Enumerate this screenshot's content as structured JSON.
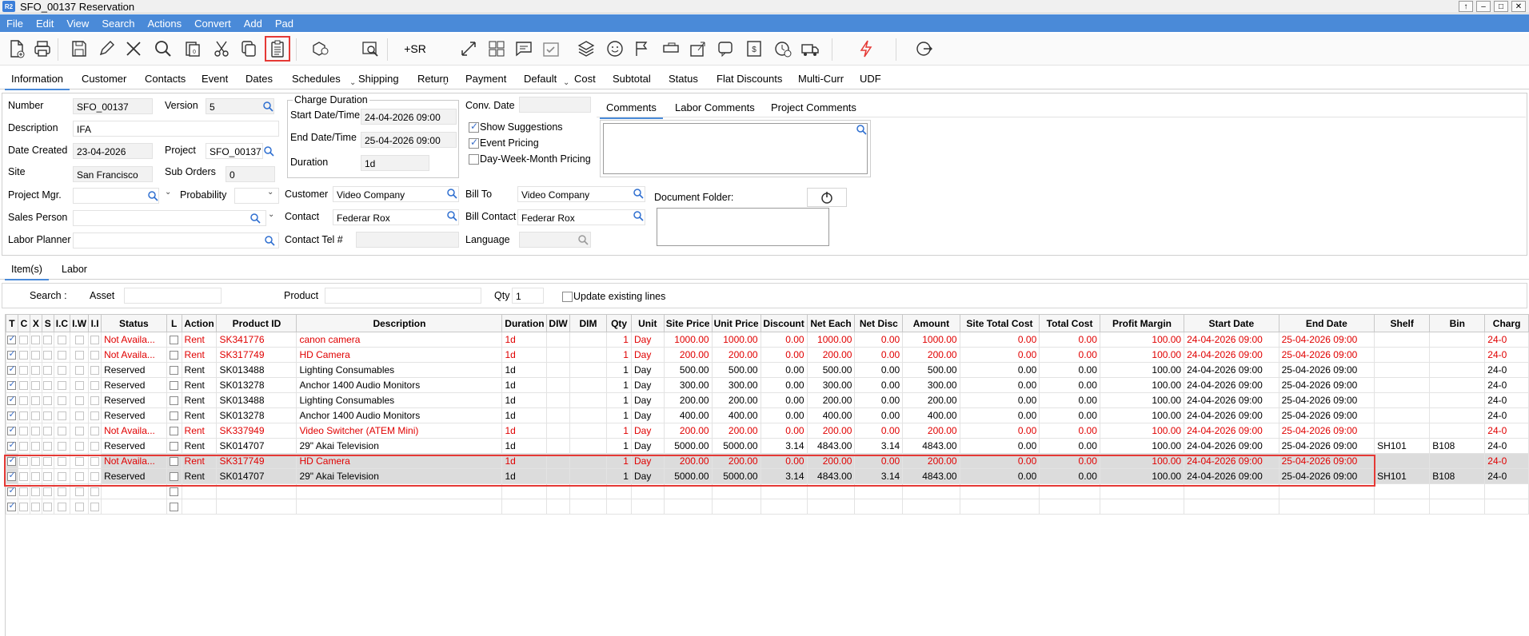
{
  "window": {
    "app_badge": "R2",
    "title": "SFO_00137 Reservation"
  },
  "menu": [
    "File",
    "Edit",
    "View",
    "Search",
    "Actions",
    "Convert",
    "Add",
    "Pad"
  ],
  "toolbar": {
    "sr_label": "+SR"
  },
  "tabs": [
    "Information",
    "Customer",
    "Contacts",
    "Event",
    "Dates",
    "Schedules",
    "Shipping",
    "Return",
    "Payment",
    "Default",
    "Cost",
    "Subtotal",
    "Status",
    "Flat Discounts",
    "Multi-Curr",
    "UDF"
  ],
  "form": {
    "number_label": "Number",
    "number": "SFO_00137",
    "version_label": "Version",
    "version": "5",
    "description_label": "Description",
    "description": "IFA",
    "date_created_label": "Date Created",
    "date_created": "23-04-2026",
    "project_label": "Project",
    "project": "SFO_00137",
    "site_label": "Site",
    "site": "San Francisco",
    "sub_orders_label": "Sub Orders",
    "sub_orders": "0",
    "project_mgr_label": "Project Mgr.",
    "probability_label": "Probability",
    "sales_person_label": "Sales Person",
    "labor_planner_label": "Labor Planner",
    "charge_duration_title": "Charge Duration",
    "start_label": "Start Date/Time",
    "start": "24-04-2026 09:00",
    "end_label": "End Date/Time",
    "end": "25-04-2026 09:00",
    "duration_label": "Duration",
    "duration": "1d",
    "conv_date_label": "Conv. Date",
    "show_suggestions": "Show Suggestions",
    "event_pricing": "Event Pricing",
    "dwm_pricing": "Day-Week-Month Pricing",
    "customer_label": "Customer",
    "customer": "Video Company",
    "contact_label": "Contact",
    "contact": "Federar Rox",
    "contact_tel_label": "Contact Tel #",
    "bill_to_label": "Bill To",
    "bill_to": "Video Company",
    "bill_contact_label": "Bill Contact",
    "bill_contact": "Federar Rox",
    "language_label": "Language",
    "comment_tabs": [
      "Comments",
      "Labor Comments",
      "Project Comments"
    ],
    "document_folder_label": "Document Folder:"
  },
  "subtabs": [
    "Item(s)",
    "Labor"
  ],
  "search": {
    "label": "Search :",
    "asset": "Asset",
    "product": "Product",
    "qty_label": "Qty",
    "qty": "1",
    "update_lines": "Update existing lines"
  },
  "grid": {
    "headers": [
      "T",
      "C",
      "X",
      "S",
      "I.C",
      "I.W",
      "I.I",
      "Status",
      "L",
      "Action",
      "Product ID",
      "Description",
      "Duration",
      "DIW",
      "DIM",
      "Qty",
      "Unit",
      "Site Price",
      "Unit Price",
      "Discount",
      "Net Each",
      "Net Disc",
      "Amount",
      "Site Total Cost",
      "Total Cost",
      "Profit Margin",
      "Start Date",
      "End Date",
      "Shelf",
      "Bin",
      "Charg"
    ],
    "rows": [
      {
        "red": true,
        "sel": false,
        "status": "Not Availa...",
        "action": "Rent",
        "pid": "SK341776",
        "desc": "canon camera",
        "dur": "1d",
        "qty": "1",
        "unit": "Day",
        "site_price": "1000.00",
        "unit_price": "1000.00",
        "disc": "0.00",
        "net_each": "1000.00",
        "net_disc": "0.00",
        "amount": "1000.00",
        "site_cost": "0.00",
        "total_cost": "0.00",
        "margin": "100.00",
        "start": "24-04-2026 09:00",
        "end": "25-04-2026 09:00",
        "shelf": "",
        "bin": "",
        "charge": "24-0"
      },
      {
        "red": true,
        "sel": false,
        "status": "Not Availa...",
        "action": "Rent",
        "pid": "SK317749",
        "desc": "HD Camera",
        "dur": "1d",
        "qty": "1",
        "unit": "Day",
        "site_price": "200.00",
        "unit_price": "200.00",
        "disc": "0.00",
        "net_each": "200.00",
        "net_disc": "0.00",
        "amount": "200.00",
        "site_cost": "0.00",
        "total_cost": "0.00",
        "margin": "100.00",
        "start": "24-04-2026 09:00",
        "end": "25-04-2026 09:00",
        "shelf": "",
        "bin": "",
        "charge": "24-0"
      },
      {
        "red": false,
        "sel": false,
        "status": "Reserved",
        "action": "Rent",
        "pid": "SK013488",
        "desc": "Lighting Consumables",
        "dur": "1d",
        "qty": "1",
        "unit": "Day",
        "site_price": "500.00",
        "unit_price": "500.00",
        "disc": "0.00",
        "net_each": "500.00",
        "net_disc": "0.00",
        "amount": "500.00",
        "site_cost": "0.00",
        "total_cost": "0.00",
        "margin": "100.00",
        "start": "24-04-2026 09:00",
        "end": "25-04-2026 09:00",
        "shelf": "",
        "bin": "",
        "charge": "24-0"
      },
      {
        "red": false,
        "sel": false,
        "status": "Reserved",
        "action": "Rent",
        "pid": "SK013278",
        "desc": "Anchor 1400 Audio Monitors",
        "dur": "1d",
        "qty": "1",
        "unit": "Day",
        "site_price": "300.00",
        "unit_price": "300.00",
        "disc": "0.00",
        "net_each": "300.00",
        "net_disc": "0.00",
        "amount": "300.00",
        "site_cost": "0.00",
        "total_cost": "0.00",
        "margin": "100.00",
        "start": "24-04-2026 09:00",
        "end": "25-04-2026 09:00",
        "shelf": "",
        "bin": "",
        "charge": "24-0"
      },
      {
        "red": false,
        "sel": false,
        "status": "Reserved",
        "action": "Rent",
        "pid": "SK013488",
        "desc": "Lighting Consumables",
        "dur": "1d",
        "qty": "1",
        "unit": "Day",
        "site_price": "200.00",
        "unit_price": "200.00",
        "disc": "0.00",
        "net_each": "200.00",
        "net_disc": "0.00",
        "amount": "200.00",
        "site_cost": "0.00",
        "total_cost": "0.00",
        "margin": "100.00",
        "start": "24-04-2026 09:00",
        "end": "25-04-2026 09:00",
        "shelf": "",
        "bin": "",
        "charge": "24-0"
      },
      {
        "red": false,
        "sel": false,
        "status": "Reserved",
        "action": "Rent",
        "pid": "SK013278",
        "desc": "Anchor 1400 Audio Monitors",
        "dur": "1d",
        "qty": "1",
        "unit": "Day",
        "site_price": "400.00",
        "unit_price": "400.00",
        "disc": "0.00",
        "net_each": "400.00",
        "net_disc": "0.00",
        "amount": "400.00",
        "site_cost": "0.00",
        "total_cost": "0.00",
        "margin": "100.00",
        "start": "24-04-2026 09:00",
        "end": "25-04-2026 09:00",
        "shelf": "",
        "bin": "",
        "charge": "24-0"
      },
      {
        "red": true,
        "sel": false,
        "status": "Not Availa...",
        "action": "Rent",
        "pid": "SK337949",
        "desc": "Video Switcher (ATEM Mini)",
        "dur": "1d",
        "qty": "1",
        "unit": "Day",
        "site_price": "200.00",
        "unit_price": "200.00",
        "disc": "0.00",
        "net_each": "200.00",
        "net_disc": "0.00",
        "amount": "200.00",
        "site_cost": "0.00",
        "total_cost": "0.00",
        "margin": "100.00",
        "start": "24-04-2026 09:00",
        "end": "25-04-2026 09:00",
        "shelf": "",
        "bin": "",
        "charge": "24-0"
      },
      {
        "red": false,
        "sel": false,
        "status": "Reserved",
        "action": "Rent",
        "pid": "SK014707",
        "desc": "29\" Akai Television",
        "dur": "1d",
        "qty": "1",
        "unit": "Day",
        "site_price": "5000.00",
        "unit_price": "5000.00",
        "disc": "3.14",
        "net_each": "4843.00",
        "net_disc": "3.14",
        "amount": "4843.00",
        "site_cost": "0.00",
        "total_cost": "0.00",
        "margin": "100.00",
        "start": "24-04-2026 09:00",
        "end": "25-04-2026 09:00",
        "shelf": "SH101",
        "bin": "B108",
        "charge": "24-0"
      },
      {
        "red": true,
        "sel": true,
        "status": "Not Availa...",
        "action": "Rent",
        "pid": "SK317749",
        "desc": "HD Camera",
        "dur": "1d",
        "qty": "1",
        "unit": "Day",
        "site_price": "200.00",
        "unit_price": "200.00",
        "disc": "0.00",
        "net_each": "200.00",
        "net_disc": "0.00",
        "amount": "200.00",
        "site_cost": "0.00",
        "total_cost": "0.00",
        "margin": "100.00",
        "start": "24-04-2026 09:00",
        "end": "25-04-2026 09:00",
        "shelf": "",
        "bin": "",
        "charge": "24-0"
      },
      {
        "red": false,
        "sel": true,
        "status": "Reserved",
        "action": "Rent",
        "pid": "SK014707",
        "desc": "29\" Akai Television",
        "dur": "1d",
        "qty": "1",
        "unit": "Day",
        "site_price": "5000.00",
        "unit_price": "5000.00",
        "disc": "3.14",
        "net_each": "4843.00",
        "net_disc": "3.14",
        "amount": "4843.00",
        "site_cost": "0.00",
        "total_cost": "0.00",
        "margin": "100.00",
        "start": "24-04-2026 09:00",
        "end": "25-04-2026 09:00",
        "shelf": "SH101",
        "bin": "B108",
        "charge": "24-0"
      }
    ]
  },
  "colors": {
    "menubar": "#4a8ad8",
    "highlight": "#e53935",
    "not_available": "#e00000"
  }
}
